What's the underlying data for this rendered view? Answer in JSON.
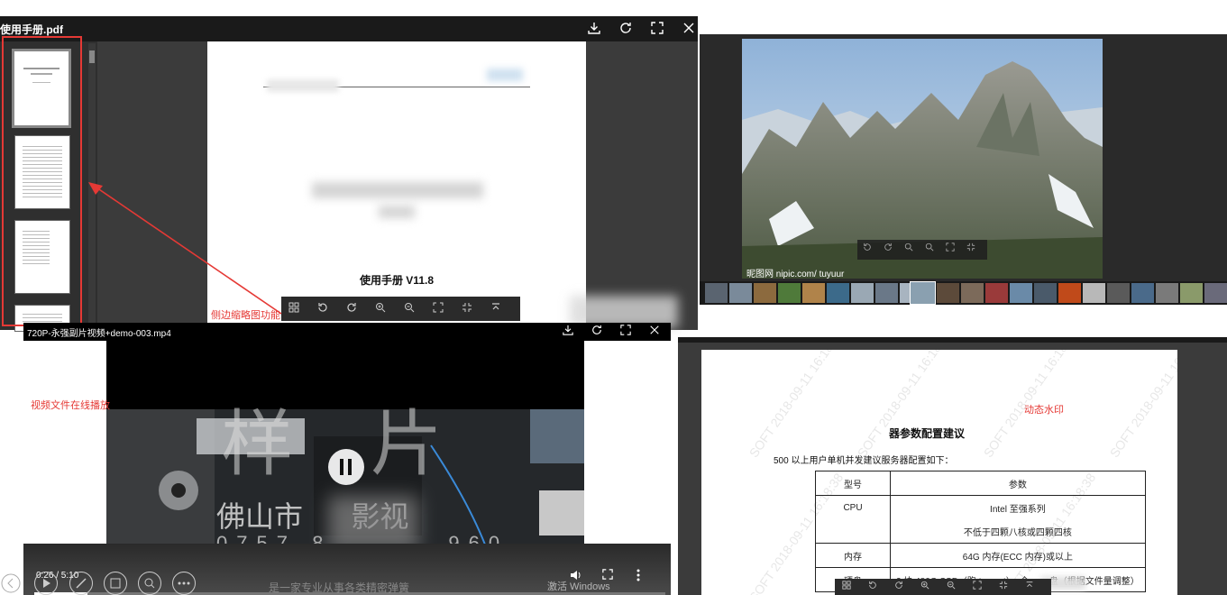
{
  "pdf_viewer": {
    "title": "使用手册.pdf",
    "page_title": "使用手册 V11.8"
  },
  "annotations": {
    "thumbnail": "侧边缩略图功能",
    "video": "视频文件在线播放",
    "watermark": "动态水印"
  },
  "image_viewer": {
    "caption": "昵图网 nipic.com/ tuyuur"
  },
  "video_player": {
    "title": "720P-永强副片视频+demo-003.mp4",
    "time_display": "0:26 / 5:10",
    "progress_fraction": 0.084,
    "watermark_big": "样 片",
    "studio_name": "佛山市      影视",
    "phone": "0757-8        960",
    "subtitle": "是一家专业从事各类精密弹簧",
    "activate_windows": "激活 Windows"
  },
  "doc_viewer": {
    "heading": "器参数配置建议",
    "intro": "500 以上用户单机并发建议服务器配置如下：",
    "table": {
      "headers": [
        "型号",
        "参数"
      ],
      "rows": [
        [
          "CPU",
          "Intel 至强系列"
        ],
        [
          "",
          "不低于四颗八核或四颗四核"
        ],
        [
          "内存",
          "64G 内存(ECC 内存)或以上"
        ],
        [
          "硬盘",
          "2 块 480G SSD（跑 tomcat）+企        盘（根据文件量调整）"
        ]
      ]
    },
    "watermark_text": "SOFT 2018-09-11 16:18:38"
  },
  "colors": {
    "annotation_red": "#e53935",
    "viewer_dark": "#2b2b2b"
  }
}
